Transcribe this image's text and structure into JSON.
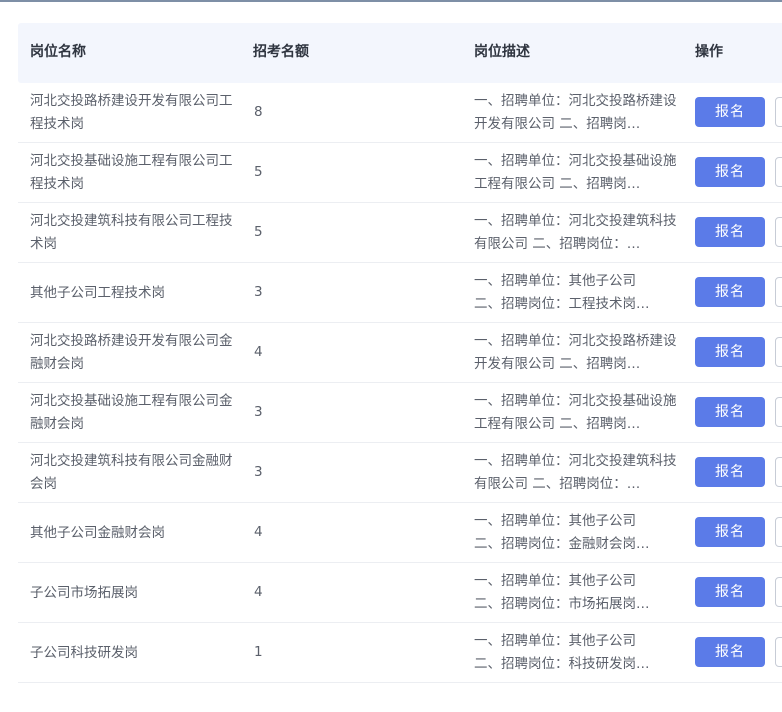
{
  "header": {
    "col_name": "岗位名称",
    "col_count": "招考名额",
    "col_desc": "岗位描述",
    "col_action": "操作"
  },
  "actions": {
    "apply_label": "报名"
  },
  "rows": [
    {
      "name": "河北交投路桥建设开发有限公司工程技术岗",
      "count": "8",
      "desc": "一、招聘单位：河北交投路桥建设开发有限公司 二、招聘岗…"
    },
    {
      "name": "河北交投基础设施工程有限公司工程技术岗",
      "count": "5",
      "desc": "一、招聘单位：河北交投基础设施工程有限公司 二、招聘岗…"
    },
    {
      "name": "河北交投建筑科技有限公司工程技术岗",
      "count": "5",
      "desc": "一、招聘单位：河北交投建筑科技有限公司 二、招聘岗位：…"
    },
    {
      "name": "其他子公司工程技术岗",
      "count": "3",
      "desc": "一、招聘单位：其他子公司\n二、招聘岗位：工程技术岗…"
    },
    {
      "name": "河北交投路桥建设开发有限公司金融财会岗",
      "count": "4",
      "desc": "一、招聘单位：河北交投路桥建设开发有限公司 二、招聘岗…"
    },
    {
      "name": "河北交投基础设施工程有限公司金融财会岗",
      "count": "3",
      "desc": "一、招聘单位：河北交投基础设施工程有限公司 二、招聘岗…"
    },
    {
      "name": "河北交投建筑科技有限公司金融财会岗",
      "count": "3",
      "desc": "一、招聘单位：河北交投建筑科技有限公司 二、招聘岗位：…"
    },
    {
      "name": "其他子公司金融财会岗",
      "count": "4",
      "desc": "一、招聘单位：其他子公司\n二、招聘岗位：金融财会岗…"
    },
    {
      "name": "子公司市场拓展岗",
      "count": "4",
      "desc": "一、招聘单位：其他子公司\n二、招聘岗位：市场拓展岗…"
    },
    {
      "name": "子公司科技研发岗",
      "count": "1",
      "desc": "一、招聘单位：其他子公司\n二、招聘岗位：科技研发岗…"
    }
  ]
}
